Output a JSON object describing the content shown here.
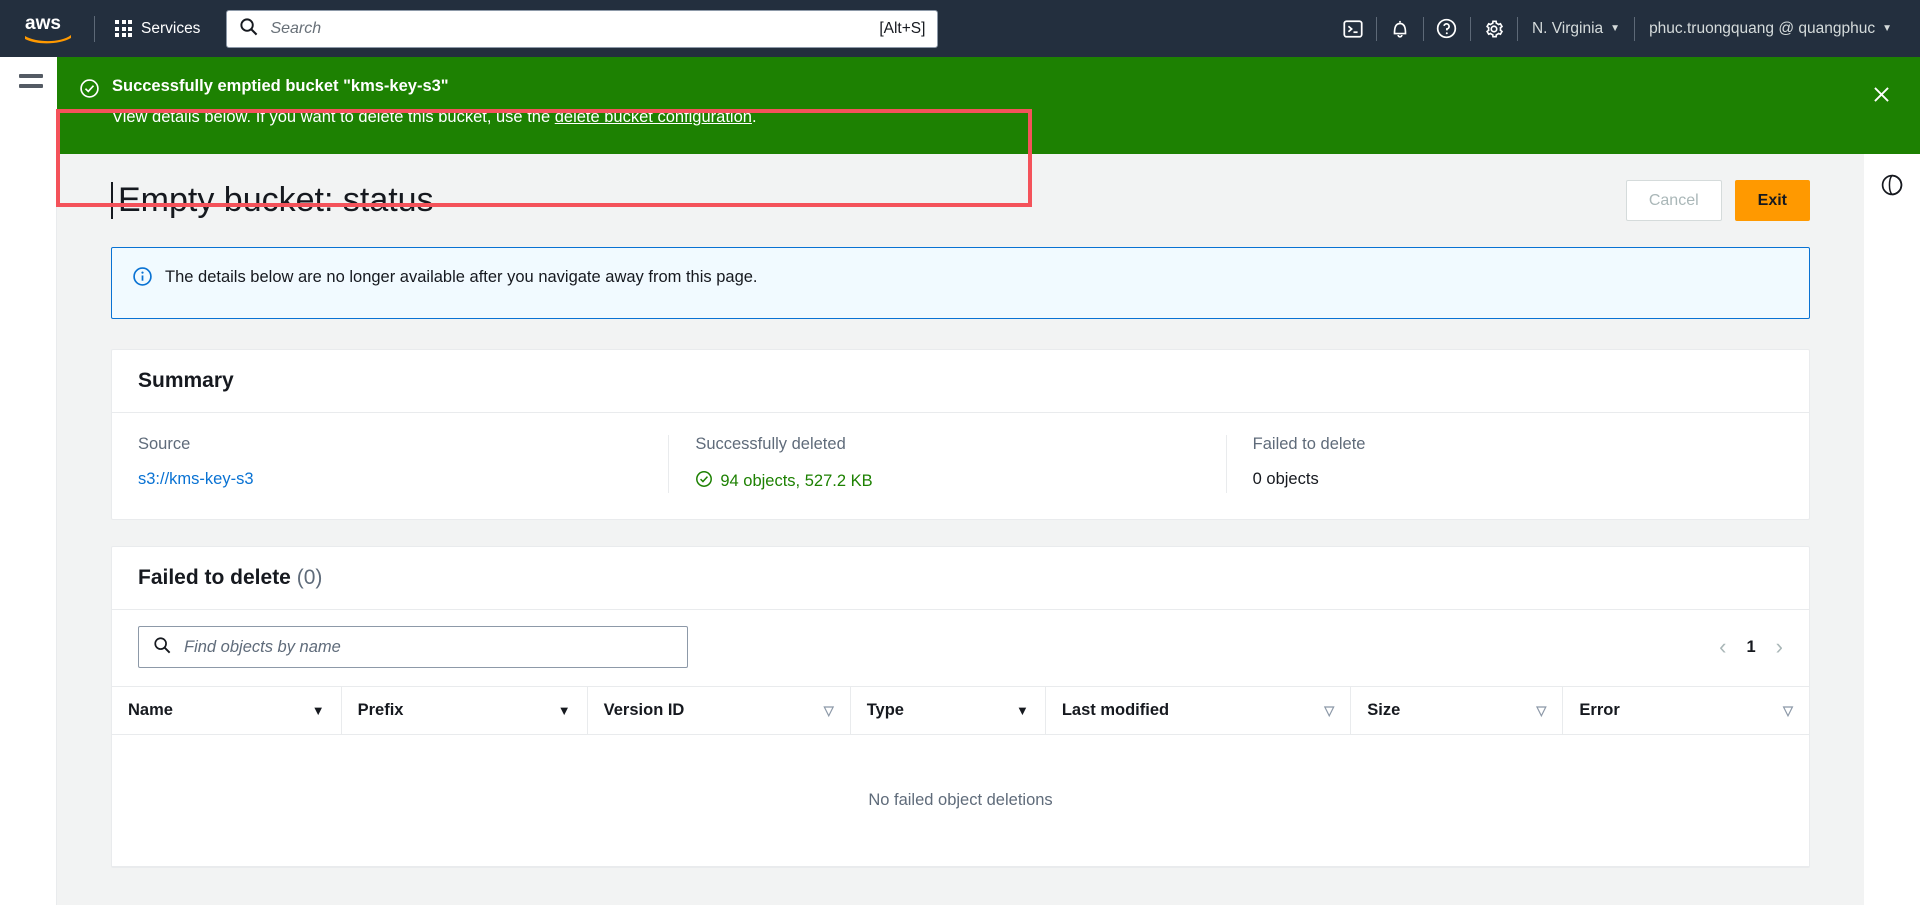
{
  "topnav": {
    "logo_alt": "aws",
    "services_label": "Services",
    "search_placeholder": "Search",
    "search_value": "",
    "search_shortcut": "[Alt+S]",
    "icons": [
      "cloudshell-icon",
      "bell-icon",
      "help-icon",
      "settings-icon"
    ],
    "region_label": "N. Virginia",
    "account_label": "phuc.truongquang @ quangphuc",
    "caret": "▼",
    "bg_color": "#232f3e"
  },
  "banner": {
    "title": "Successfully emptied bucket \"kms-key-s3\"",
    "body_before": "View details below. If you want to delete this bucket, use the ",
    "body_link": "delete bucket configuration",
    "body_after": ".",
    "bg_color": "#1d8102",
    "highlight_color": "#f4525a",
    "close_label": "✕"
  },
  "page": {
    "title": "Empty bucket: status",
    "cancel_label": "Cancel",
    "exit_label": "Exit",
    "exit_color": "#ff9900"
  },
  "info_alert": {
    "text": "The details below are no longer available after you navigate away from this page.",
    "border_color": "#0972d3",
    "bg_color": "#f1faff"
  },
  "summary": {
    "heading": "Summary",
    "columns": [
      {
        "label": "Source",
        "value": "s3://kms-key-s3",
        "kind": "link"
      },
      {
        "label": "Successfully deleted",
        "value": "94 objects, 527.2 KB",
        "kind": "success"
      },
      {
        "label": "Failed to delete",
        "value": "0 objects",
        "kind": "plain"
      }
    ],
    "success_color": "#1d8102",
    "link_color": "#0972d3"
  },
  "failed_table": {
    "heading": "Failed to delete",
    "count": "(0)",
    "search_placeholder": "Find objects by name",
    "search_value": "",
    "pagination": {
      "prev": "‹",
      "page": "1",
      "next": "›"
    },
    "columns": [
      {
        "label": "Name",
        "sort": "solid"
      },
      {
        "label": "Prefix",
        "sort": "solid"
      },
      {
        "label": "Version ID",
        "sort": "hollow"
      },
      {
        "label": "Type",
        "sort": "solid"
      },
      {
        "label": "Last modified",
        "sort": "hollow"
      },
      {
        "label": "Size",
        "sort": "hollow"
      },
      {
        "label": "Error",
        "sort": "hollow"
      }
    ],
    "rows": [],
    "empty_text": "No failed object deletions"
  }
}
